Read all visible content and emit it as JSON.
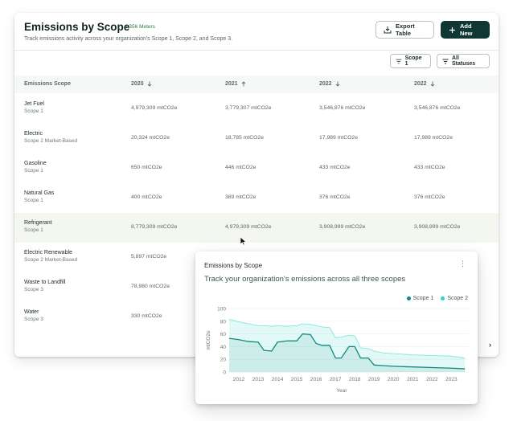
{
  "header": {
    "title": "Emissions by Scope",
    "badge": "2,356 Meters",
    "subtitle": "Track emissions activity across your organization's Scope 1, Scope 2, and Scope 3.",
    "export_label": "Export Table",
    "add_label": "Add New"
  },
  "filters": {
    "scope_label": "Scope 1",
    "status_label": "All Statuses"
  },
  "table": {
    "columns": [
      "Emissions Scope",
      "2020",
      "2021",
      "2022",
      "2022"
    ],
    "column_sort": [
      "",
      "down",
      "up",
      "down",
      "down"
    ],
    "rows": [
      {
        "name": "Jet Fuel",
        "scope": "Scope 1",
        "v1": "4,979,309 mtCO2e",
        "v2": "3,779,307 mtCO2e",
        "v3": "3,546,876 mtCO2e",
        "v4": "3,546,876 mtCO2e"
      },
      {
        "name": "Electric",
        "scope": "Scope 2 Market-Based",
        "v1": "20,324 mtCO2e",
        "v2": "18,785 mtCO2e",
        "v3": "17,989 mtCO2e",
        "v4": "17,989 mtCO2e"
      },
      {
        "name": "Gasoline",
        "scope": "Scope 1",
        "v1": "650 mtCO2e",
        "v2": "446 mtCO2e",
        "v3": "433 mtCO2e",
        "v4": "433 mtCO2e"
      },
      {
        "name": "Natural Gas",
        "scope": "Scope 1",
        "v1": "400 mtCO2e",
        "v2": "389 mtCO2e",
        "v3": "376 mtCO2e",
        "v4": "376 mtCO2e"
      },
      {
        "name": "Refrigerant",
        "scope": "Scope 1",
        "v1": "8,779,309 mtCO2e",
        "v2": "4,979,309 mtCO2e",
        "v3": "3,908,999 mtCO2e",
        "v4": "3,908,999 mtCO2e"
      },
      {
        "name": "Electric Renewable",
        "scope": "Scope 2 Market-Based",
        "v1": "5,897 mtCO2e",
        "v2": "",
        "v3": "",
        "v4": ""
      },
      {
        "name": "Waste to Landfill",
        "scope": "Scope 3",
        "v1": "78,980 mtCO2e",
        "v2": "",
        "v3": "",
        "v4": ""
      },
      {
        "name": "Water",
        "scope": "Scope 3",
        "v1": "330 mtCO2e",
        "v2": "",
        "v3": "",
        "v4": ""
      }
    ],
    "highlighted_row": 4
  },
  "pagination_icon": "chevron-right-icon",
  "popup": {
    "title": "Emissions by Scope",
    "subtitle": "Track your organization's emissions across all three scopes",
    "menu_icon": "kebab-menu-icon"
  },
  "chart_data": {
    "type": "area",
    "ylabel": "mtCO2e",
    "xlabel": "Year",
    "ylim": [
      0,
      100
    ],
    "yticks": [
      0,
      20,
      40,
      60,
      80,
      100
    ],
    "xticks": [
      "2012",
      "2013",
      "2014",
      "2015",
      "2016",
      "2017",
      "2018",
      "2019",
      "2020",
      "2021",
      "2022",
      "2023"
    ],
    "legend_position": "top-right",
    "x": [
      2011.5,
      2012,
      2012.5,
      2013,
      2013.3,
      2013.7,
      2014,
      2014.5,
      2015,
      2015.3,
      2015.7,
      2016,
      2016.3,
      2016.7,
      2017,
      2017.3,
      2017.7,
      2018,
      2018.3,
      2018.7,
      2019,
      2019.5,
      2020,
      2021,
      2022,
      2023,
      2023.7
    ],
    "series": [
      {
        "name": "Scope 1",
        "color": "#118a7e",
        "values": [
          53,
          51,
          48,
          47,
          34,
          33,
          47,
          49,
          49,
          60,
          59,
          45,
          42,
          42,
          22,
          22,
          40,
          40,
          22,
          22,
          11,
          10,
          9,
          8,
          7,
          6,
          5
        ]
      },
      {
        "name": "Scope 2",
        "color": "#2fd6c6",
        "values": [
          83,
          79,
          76,
          73,
          73,
          72,
          73,
          72,
          73,
          76,
          75,
          73,
          71,
          70,
          54,
          55,
          58,
          57,
          38,
          37,
          33,
          30,
          29,
          27,
          26,
          25,
          22
        ]
      }
    ],
    "grid": true
  },
  "colors": {
    "brand_dark": "#103733",
    "badge_green": "#2a7a43",
    "scope1": "#118a7e",
    "scope2": "#2fd6c6"
  }
}
